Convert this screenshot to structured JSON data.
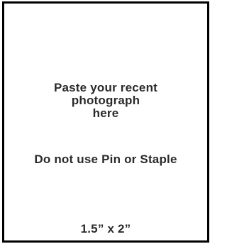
{
  "photo_box": {
    "paste_lines": [
      "Paste your recent",
      "photograph",
      "here"
    ],
    "warning": "Do not use Pin or Staple",
    "size": "1.5” x 2”"
  },
  "colors": {
    "border": "#000000",
    "text": "#2a2a2a",
    "background": "#ffffff"
  }
}
